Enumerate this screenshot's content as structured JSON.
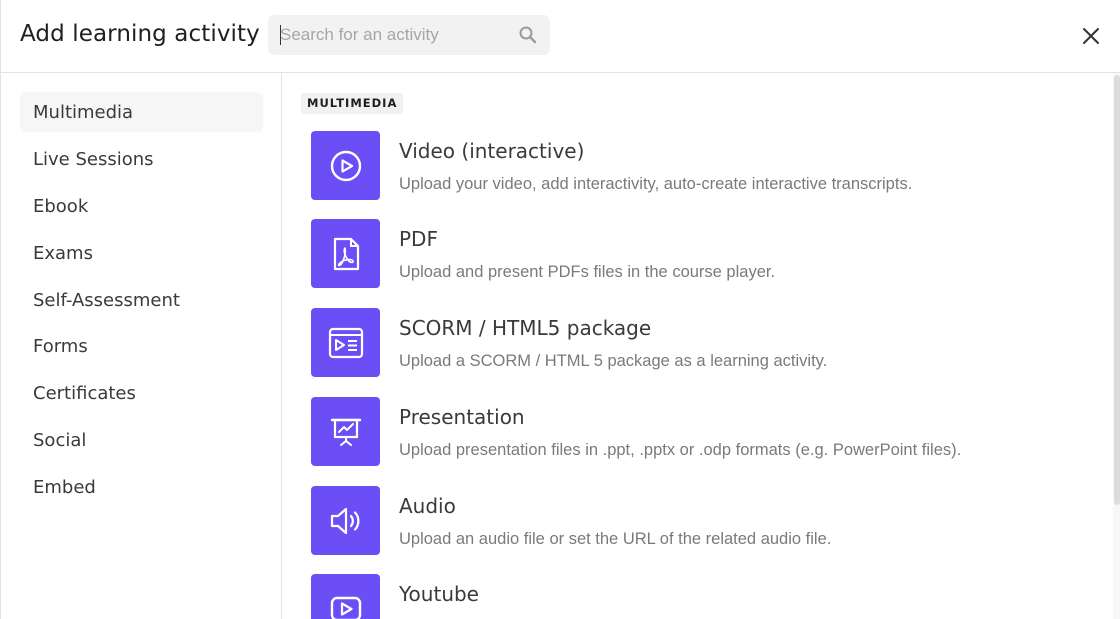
{
  "header": {
    "title": "Add learning activity",
    "search_placeholder": "Search for an activity",
    "search_value": ""
  },
  "sidebar": {
    "items": [
      {
        "label": "Multimedia",
        "active": true
      },
      {
        "label": "Live Sessions"
      },
      {
        "label": "Ebook"
      },
      {
        "label": "Exams"
      },
      {
        "label": "Self-Assessment"
      },
      {
        "label": "Forms"
      },
      {
        "label": "Certificates"
      },
      {
        "label": "Social"
      },
      {
        "label": "Embed"
      }
    ]
  },
  "content": {
    "section_label": "MULTIMEDIA",
    "activities": [
      {
        "name": "Video (interactive)",
        "desc": "Upload your video, add interactivity, auto-create interactive transcripts.",
        "icon": "play-circle-icon"
      },
      {
        "name": "PDF",
        "desc": "Upload and present PDFs files in the course player.",
        "icon": "pdf-icon"
      },
      {
        "name": "SCORM / HTML5 package",
        "desc": "Upload a SCORM / HTML 5 package as a learning activity.",
        "icon": "scorm-package-icon"
      },
      {
        "name": "Presentation",
        "desc": "Upload presentation files in .ppt, .pptx or .odp formats (e.g. PowerPoint files).",
        "icon": "presentation-icon"
      },
      {
        "name": "Audio",
        "desc": "Upload an audio file or set the URL of the related audio file.",
        "icon": "speaker-icon"
      },
      {
        "name": "Youtube",
        "desc": "",
        "icon": "youtube-icon"
      }
    ]
  },
  "colors": {
    "accent": "#6b4ef6",
    "active_bg": "#f6f6f6",
    "search_bg": "#f2f2f2"
  }
}
